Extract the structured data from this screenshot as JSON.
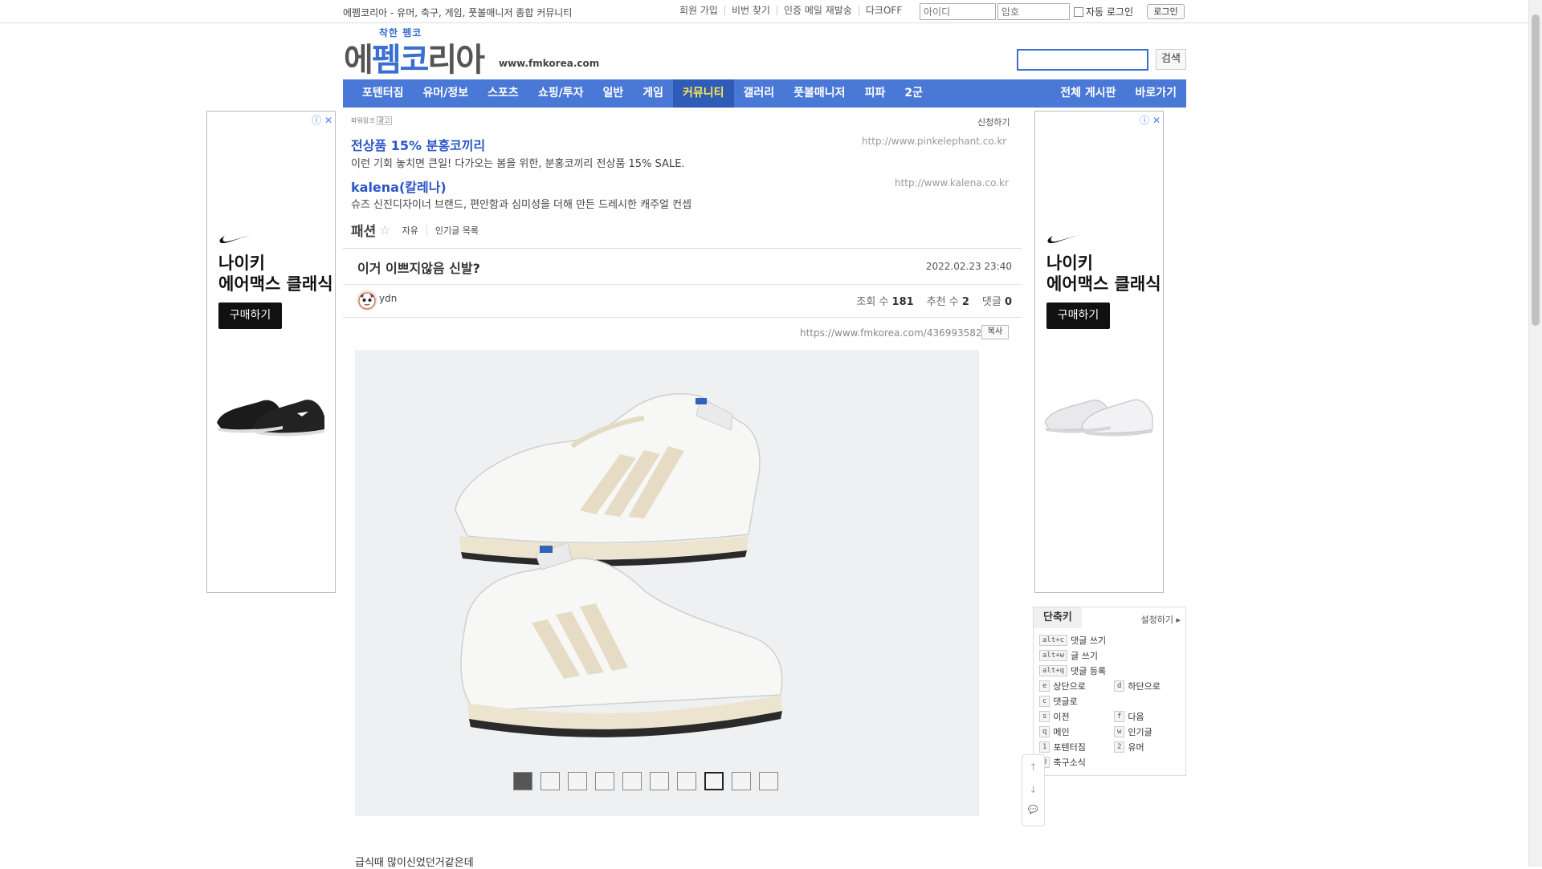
{
  "topbar": {
    "site_desc": "에펨코리아 - 유머, 축구, 게임, 풋볼매니저 종합 커뮤니티",
    "links": [
      "회원 가입",
      "비번 찾기",
      "인증 메일 재발송",
      "다크OFF"
    ],
    "id_placeholder": "아이디",
    "pw_placeholder": "암호",
    "auto_login": "자동 로그인",
    "login": "로그인"
  },
  "header": {
    "logo_small": "착한 펨코",
    "logo_main_a": "에",
    "logo_main_b": "펨코",
    "logo_main_c": "리아",
    "domain": "www.fmkorea.com",
    "search_button": "검색"
  },
  "nav": {
    "items": [
      "포텐터짐",
      "유머/정보",
      "스포츠",
      "쇼핑/투자",
      "일반",
      "게임",
      "커뮤니티",
      "갤러리",
      "풋볼매니저",
      "피파",
      "2군"
    ],
    "active": "커뮤니티",
    "right_items": [
      "전체 게시판",
      "바로가기"
    ]
  },
  "side_ad": {
    "title_line1": "나이키",
    "title_line2": "에어맥스 클래식",
    "button": "구매하기",
    "info_icon": "ⓘ",
    "close_icon": "✕"
  },
  "powerlink": {
    "label": "파워링크",
    "ad_badge": "광고",
    "request": "신청하기",
    "ads": [
      {
        "title": "전상품 15% 분홍코끼리",
        "url": "http://www.pinkelephant.co.kr",
        "desc": "이런 기회 놓치면 큰일! 다가오는 봄을 위한, 분홍코끼리 전상품 15% SALE."
      },
      {
        "title": "kalena(칼레나)",
        "url": "http://www.kalena.co.kr",
        "desc": "슈즈 신진디자이너 브랜드, 편안함과 심미성을 더해 만든 드레시한 캐주얼 컨셉"
      }
    ]
  },
  "board": {
    "name": "패션",
    "star": "☆",
    "tags": [
      "자유",
      "인기글 목록"
    ]
  },
  "post": {
    "title": "이거 이쁘지않음 신발?",
    "date": "2022.02.23 23:40",
    "author": "ydn",
    "views_label": "조회 수",
    "views": "181",
    "recommend_label": "추천 수",
    "recommend": "2",
    "comments_label": "댓글",
    "comments": "0",
    "url": "https://www.fmkorea.com/4369935829",
    "copy": "복사",
    "body": "급식때 많이신었던거같은데"
  },
  "gallery": {
    "thumb_count": 10,
    "selected_index": 7
  },
  "shortcuts": {
    "title": "단축키",
    "settings": "설정하기",
    "rows": [
      {
        "key": "alt+c",
        "label": "댓글 쓰기"
      },
      {
        "key": "alt+w",
        "label": "글 쓰기"
      },
      {
        "key": "alt+q",
        "label": "댓글 등록"
      },
      {
        "key": "e",
        "label": "상단으로",
        "key2": "d",
        "label2": "하단으로"
      },
      {
        "key": "c",
        "label": "댓글로"
      },
      {
        "key": "s",
        "label": "이전",
        "key2": "f",
        "label2": "다음"
      },
      {
        "key": "q",
        "label": "메인",
        "key2": "w",
        "label2": "인기글"
      },
      {
        "key": "1",
        "label": "포텐터짐",
        "key2": "2",
        "label2": "유머"
      },
      {
        "key": "3",
        "label": "축구소식"
      }
    ]
  },
  "float_buttons": {
    "up": "↑",
    "down": "↓",
    "comment": "💬"
  },
  "colors": {
    "nav": "#4a78d6",
    "nav_active_text": "#ffe94d",
    "link": "#2a56c6"
  }
}
